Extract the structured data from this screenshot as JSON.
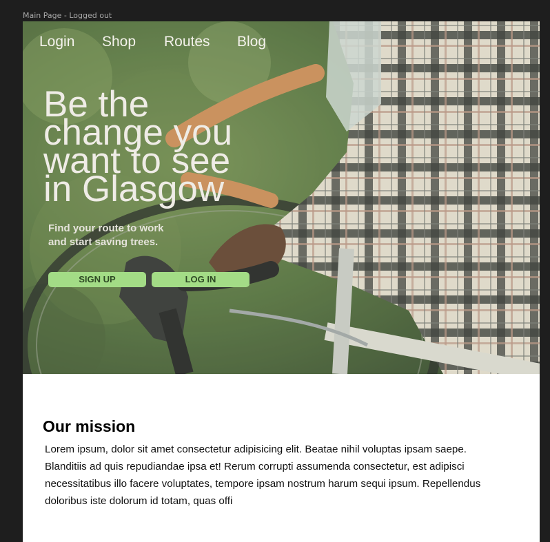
{
  "frame": {
    "label": "Main Page - Logged out"
  },
  "nav": {
    "items": [
      {
        "label": "Login"
      },
      {
        "label": "Shop"
      },
      {
        "label": "Routes"
      },
      {
        "label": "Blog"
      }
    ]
  },
  "hero": {
    "title_lines": [
      "Be the",
      "change you",
      "want to see",
      "in Glasgow"
    ],
    "subtitle_lines": [
      "Find your route to work",
      "and start saving trees."
    ],
    "signup_label": "SIGN UP",
    "login_label": "LOG IN"
  },
  "mission": {
    "title": "Our mission",
    "body": "Lorem ipsum, dolor sit amet consectetur adipisicing elit. Beatae nihil voluptas ipsam saepe. Blanditiis ad quis repudiandae ipsa et! Rerum corrupti assumenda consectetur, est adipisci necessitatibus illo facere voluptates, tempore ipsam nostrum harum sequi ipsum. Repellendus doloribus iste dolorum id totam, quas offi"
  },
  "colors": {
    "button_bg": "#a3dc86",
    "canvas_bg": "#1e1e1e",
    "frame_bg": "#ffffff"
  }
}
